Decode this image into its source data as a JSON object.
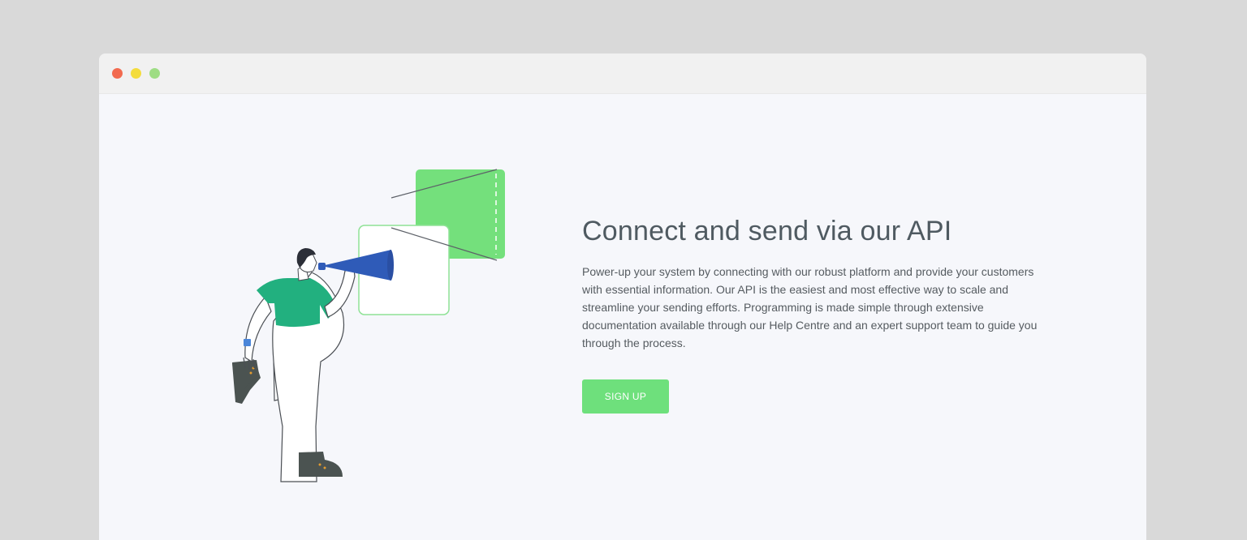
{
  "window": {
    "controls": [
      "close-dot",
      "minimize-dot",
      "maximize-dot"
    ]
  },
  "hero": {
    "title": "Connect and send via our API",
    "description": "Power-up your system by connecting with our robust platform and provide your customers with essential information. Our API is the easiest and most effective way to scale and streamline your sending efforts. Programming is made simple through extensive documentation available through our Help Centre and an expert support team to guide you through the process.",
    "cta_label": "SIGN UP"
  },
  "colors": {
    "page_background": "#d9d9d9",
    "window_background": "#f6f7fb",
    "titlebar": "#f1f1f1",
    "accent_green": "#6ee07c",
    "shirt_green": "#22b07f",
    "megaphone_blue": "#2f5bb8",
    "headline_text": "#4f5a61"
  },
  "illustration": {
    "subject": "person-with-megaphone-icon"
  }
}
